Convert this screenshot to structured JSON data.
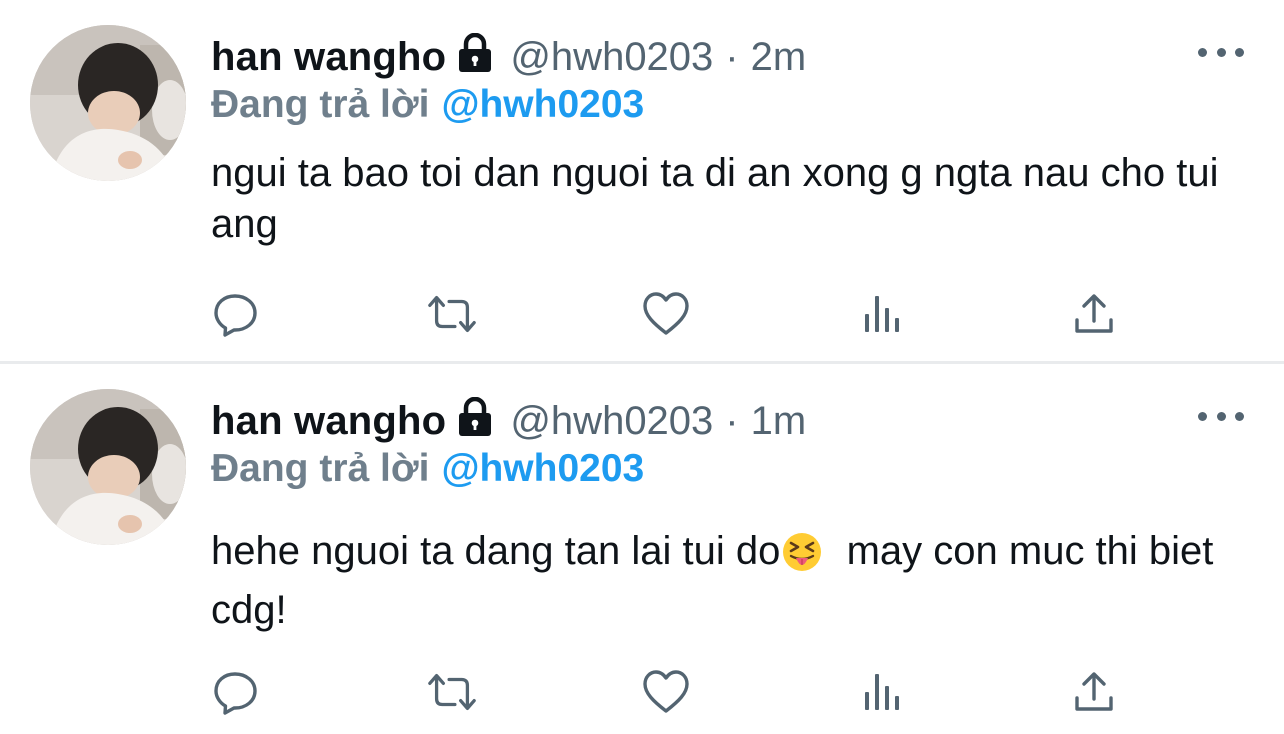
{
  "colors": {
    "text_primary": "#0f1419",
    "text_secondary": "#536471",
    "reply_label": "#6f7f8c",
    "link_blue": "#1d9bf0",
    "divider": "#e9ebed"
  },
  "tweets": [
    {
      "display_name": "han wangho",
      "handle": "@hwh0203",
      "separator": "·",
      "time": "2m",
      "replying_label": "Đang trả lời",
      "replying_to": "@hwh0203",
      "text": "ngui ta bao toi dan nguoi ta di an xong g ngta nau cho tui ang",
      "emoji": null
    },
    {
      "display_name": "han wangho",
      "handle": "@hwh0203",
      "separator": "·",
      "time": "1m",
      "replying_label": "Đang trả lời",
      "replying_to": "@hwh0203",
      "text_before_emoji": "hehe nguoi ta dang tan lai tui do",
      "emoji": "squinting-face-with-tongue",
      "text_after_emoji": "  may con muc thi biet cdg!"
    }
  ],
  "icons": {
    "lock": "lock-icon",
    "more": "more-icon",
    "reply": "reply-icon",
    "retweet": "retweet-icon",
    "like": "like-icon",
    "views": "views-icon",
    "share": "share-icon"
  }
}
